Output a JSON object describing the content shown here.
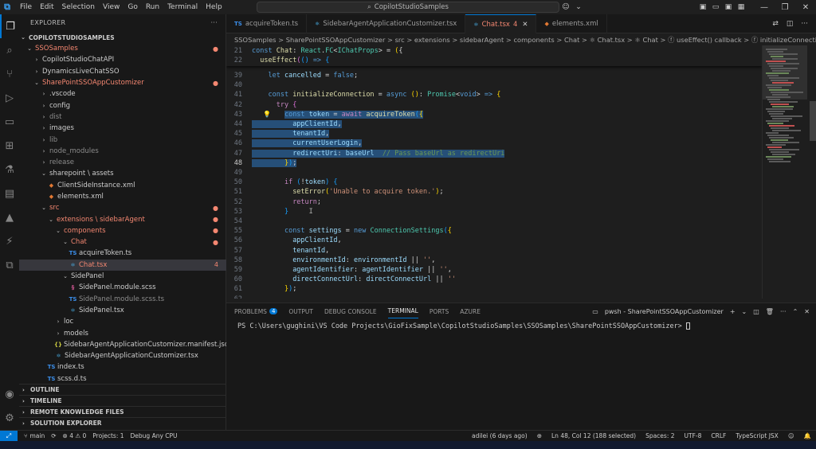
{
  "titlebar": {
    "menu": [
      "File",
      "Edit",
      "Selection",
      "View",
      "Go",
      "Run",
      "Terminal",
      "Help"
    ],
    "search_text": "CopilotStudioSamples"
  },
  "explorer": {
    "title": "EXPLORER",
    "root": "COPILOTSTUDIOSAMPLES",
    "tree": [
      {
        "indent": 0,
        "chev": "⌄",
        "label": "SSOSamples",
        "color": "#f48771",
        "badge": "●",
        "badge_color": "#f48771"
      },
      {
        "indent": 1,
        "chev": "›",
        "label": "CopilotStudioChatAPI"
      },
      {
        "indent": 1,
        "chev": "›",
        "label": "DynamicsLiveChatSSO"
      },
      {
        "indent": 1,
        "chev": "⌄",
        "label": "SharePointSSOAppCustomizer",
        "color": "#f48771",
        "badge": "●",
        "badge_color": "#f48771"
      },
      {
        "indent": 2,
        "chev": "›",
        "label": ".vscode"
      },
      {
        "indent": 2,
        "chev": "›",
        "label": "config"
      },
      {
        "indent": 2,
        "chev": "›",
        "label": "dist",
        "color": "#8c8c8c"
      },
      {
        "indent": 2,
        "chev": "›",
        "label": "images"
      },
      {
        "indent": 2,
        "chev": "›",
        "label": "lib",
        "color": "#8c8c8c"
      },
      {
        "indent": 2,
        "chev": "›",
        "label": "node_modules",
        "color": "#8c8c8c"
      },
      {
        "indent": 2,
        "chev": "›",
        "label": "release",
        "color": "#8c8c8c"
      },
      {
        "indent": 2,
        "chev": "⌄",
        "label": "sharepoint \\ assets"
      },
      {
        "indent": 3,
        "icon": "◆",
        "icon_class": "xml",
        "label": "ClientSideInstance.xml"
      },
      {
        "indent": 3,
        "icon": "◆",
        "icon_class": "xml",
        "label": "elements.xml"
      },
      {
        "indent": 2,
        "chev": "⌄",
        "label": "src",
        "color": "#f48771",
        "badge": "●",
        "badge_color": "#f48771"
      },
      {
        "indent": 3,
        "chev": "⌄",
        "label": "extensions \\ sidebarAgent",
        "color": "#f48771",
        "badge": "●",
        "badge_color": "#f48771"
      },
      {
        "indent": 4,
        "chev": "⌄",
        "label": "components",
        "color": "#f48771",
        "badge": "●",
        "badge_color": "#f48771"
      },
      {
        "indent": 5,
        "chev": "⌄",
        "label": "Chat",
        "color": "#f48771",
        "badge": "●",
        "badge_color": "#f48771"
      },
      {
        "indent": 6,
        "icon": "TS",
        "icon_class": "ts",
        "label": "acquireToken.ts"
      },
      {
        "indent": 6,
        "icon": "⚛",
        "icon_class": "tsx",
        "label": "Chat.tsx",
        "color": "#f48771",
        "badge": "4",
        "badge_color": "#f48771",
        "selected": true
      },
      {
        "indent": 5,
        "chev": "⌄",
        "label": "SidePanel"
      },
      {
        "indent": 6,
        "icon": "§",
        "icon_class": "scss",
        "label": "SidePanel.module.scss"
      },
      {
        "indent": 6,
        "icon": "TS",
        "icon_class": "ts",
        "label": "SidePanel.module.scss.ts",
        "color": "#8c8c8c"
      },
      {
        "indent": 6,
        "icon": "⚛",
        "icon_class": "tsx",
        "label": "SidePanel.tsx"
      },
      {
        "indent": 4,
        "chev": "›",
        "label": "loc"
      },
      {
        "indent": 4,
        "chev": "›",
        "label": "models"
      },
      {
        "indent": 4,
        "icon": "{}",
        "icon_class": "json",
        "label": "SidebarAgentApplicationCustomizer.manifest.json"
      },
      {
        "indent": 4,
        "icon": "⚛",
        "icon_class": "tsx",
        "label": "SidebarAgentApplicationCustomizer.tsx"
      },
      {
        "indent": 3,
        "icon": "TS",
        "icon_class": "ts",
        "label": "index.ts"
      },
      {
        "indent": 3,
        "icon": "TS",
        "icon_class": "ts",
        "label": "scss.d.ts"
      }
    ],
    "sections": [
      "OUTLINE",
      "TIMELINE",
      "REMOTE KNOWLEDGE FILES",
      "SOLUTION EXPLORER"
    ]
  },
  "tabs": [
    {
      "icon": "TS",
      "icon_class": "ts",
      "label": "acquireToken.ts"
    },
    {
      "icon": "⚛",
      "icon_class": "tsx",
      "label": "SidebarAgentApplicationCustomizer.tsx"
    },
    {
      "icon": "⚛",
      "icon_class": "tsx",
      "label": "Chat.tsx",
      "modified": "4",
      "active": true
    },
    {
      "icon": "◆",
      "icon_class": "xml",
      "label": "elements.xml"
    }
  ],
  "breadcrumb": "SSOSamples > SharePointSSOAppCustomizer > src > extensions > sidebarAgent > components > Chat > ⚛ Chat.tsx > ⚛ Chat > ⓕ useEffect() callback > ⓕ initializeConnection",
  "editor": {
    "sticky": [
      {
        "n": "21",
        "html": "<span class='kw'>const</span> <span class='fn'>Chat</span>: <span class='ty'>React</span>.<span class='ty'>FC</span>&lt;<span class='ty'>IChatProps</span>&gt; = <span class='br1'>(</span>{"
      },
      {
        "n": "22",
        "html": "  <span class='fn'>useEffect</span><span class='br2'>(</span><span class='br3'>(</span><span class='br3'>)</span> <span class='kw'>=&gt;</span> <span class='br3'>{</span>"
      }
    ],
    "lines": [
      {
        "n": "39",
        "html": "    <span class='kw'>let</span> <span class='var'>cancelled</span> = <span class='kw'>false</span>;"
      },
      {
        "n": "40",
        "html": ""
      },
      {
        "n": "41",
        "html": "    <span class='kw'>const</span> <span class='fn'>initializeConnection</span> = <span class='kw'>async</span> <span class='br1'>(</span><span class='br1'>)</span>: <span class='ty'>Promise</span>&lt;<span class='kw'>void</span>&gt; <span class='kw'>=&gt;</span> <span class='br1'>{</span>"
      },
      {
        "n": "42",
        "html": "      <span class='kw2'>try</span> <span class='br2'>{</span>"
      },
      {
        "n": "43",
        "html": "        <span class='sel'><span class='kw'>const</span> <span class='var'>token</span> = <span class='kw2'>await</span> <span class='fn'>acquireToken</span><span class='br3'>(</span><span class='br1'>{</span></span>",
        "bulb": true
      },
      {
        "n": "44",
        "html": "<span class='sel'>          <span class='var'>appClientId</span>,</span>"
      },
      {
        "n": "45",
        "html": "<span class='sel'>          <span class='var'>tenantId</span>,</span>"
      },
      {
        "n": "46",
        "html": "<span class='sel'>          <span class='var'>currentUserLogin</span>,</span>"
      },
      {
        "n": "47",
        "html": "<span class='sel'>          <span class='var'>redirectUri</span>: <span class='var'>baseUrl</span>  <span class='cmt'>// Pass baseUrl as redirectUri</span></span>"
      },
      {
        "n": "48",
        "html": "<span class='sel'>        <span class='br1'>}</span><span class='br3'>)</span>;</span>",
        "current": true
      },
      {
        "n": "49",
        "html": ""
      },
      {
        "n": "50",
        "html": "        <span class='kw2'>if</span> <span class='br3'>(</span>!<span class='var'>token</span><span class='br3'>)</span> <span class='br3'>{</span>"
      },
      {
        "n": "51",
        "html": "          <span class='fn'>setError</span><span class='br1'>(</span><span class='str'>'Unable to acquire token.'</span><span class='br1'>)</span>;"
      },
      {
        "n": "52",
        "html": "          <span class='kw2'>return</span>;"
      },
      {
        "n": "53",
        "html": "        <span class='br3'>}</span>     <span style='color:#aeafad'>I</span>"
      },
      {
        "n": "54",
        "html": ""
      },
      {
        "n": "55",
        "html": "        <span class='kw'>const</span> <span class='var'>settings</span> = <span class='kw'>new</span> <span class='ty'>ConnectionSettings</span><span class='br3'>(</span><span class='br1'>{</span>"
      },
      {
        "n": "56",
        "html": "          <span class='var'>appClientId</span>,"
      },
      {
        "n": "57",
        "html": "          <span class='var'>tenantId</span>,"
      },
      {
        "n": "58",
        "html": "          <span class='var'>environmentId</span>: <span class='var'>environmentId</span> || <span class='str'>''</span>,"
      },
      {
        "n": "59",
        "html": "          <span class='var'>agentIdentifier</span>: <span class='var'>agentIdentifier</span> || <span class='str'>''</span>,"
      },
      {
        "n": "60",
        "html": "          <span class='var'>directConnectUrl</span>: <span class='var'>directConnectUrl</span> || <span class='str'>''</span>"
      },
      {
        "n": "61",
        "html": "        <span class='br1'>}</span><span class='br3'>)</span>;"
      },
      {
        "n": "62",
        "html": ""
      }
    ]
  },
  "panel": {
    "tabs": [
      {
        "label": "PROBLEMS",
        "badge": "4"
      },
      {
        "label": "OUTPUT"
      },
      {
        "label": "DEBUG CONSOLE"
      },
      {
        "label": "TERMINAL",
        "active": true
      },
      {
        "label": "PORTS"
      },
      {
        "label": "AZURE"
      }
    ],
    "terminal_name": "pwsh - SharePointSSOAppCustomizer",
    "prompt": "PS C:\\Users\\gughini\\VS Code Projects\\GioFixSample\\CopilotStudioSamples\\SSOSamples\\SharePointSSOAppCustomizer>"
  },
  "statusbar": {
    "branch": "main",
    "problems": "⊗ 4 ⚠ 0",
    "projects": "Projects: 1",
    "debug": "Debug Any CPU",
    "blame": "adilei (6 days ago)",
    "position": "Ln 48, Col 12 (188 selected)",
    "spaces": "Spaces: 2",
    "encoding": "UTF-8",
    "eol": "CRLF",
    "language": "TypeScript JSX"
  },
  "colors": {
    "accent": "#0078d4",
    "modified": "#f48771",
    "selection": "#264f78"
  }
}
